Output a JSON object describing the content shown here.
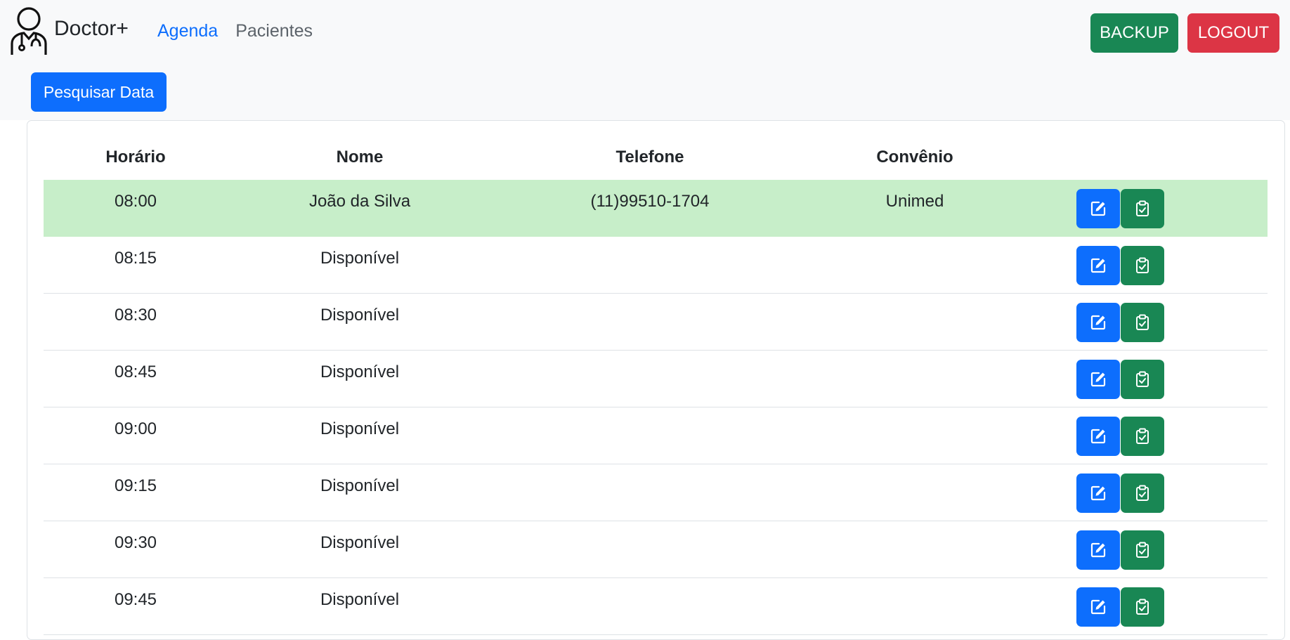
{
  "brand": {
    "name": "Doctor+",
    "icon": "doctor-icon"
  },
  "nav": {
    "agenda": "Agenda",
    "pacientes": "Pacientes"
  },
  "actions": {
    "backup": "BACKUP",
    "logout": "LOGOUT",
    "search_date": "Pesquisar Data"
  },
  "table": {
    "headers": [
      "Horário",
      "Nome",
      "Telefone",
      "Convênio"
    ],
    "rows": [
      {
        "time": "08:00",
        "name": "João da Silva",
        "phone": "(11)99510-1704",
        "plan": "Unimed",
        "highlight": true
      },
      {
        "time": "08:15",
        "name": "Disponível",
        "phone": "",
        "plan": ""
      },
      {
        "time": "08:30",
        "name": "Disponível",
        "phone": "",
        "plan": ""
      },
      {
        "time": "08:45",
        "name": "Disponível",
        "phone": "",
        "plan": ""
      },
      {
        "time": "09:00",
        "name": "Disponível",
        "phone": "",
        "plan": ""
      },
      {
        "time": "09:15",
        "name": "Disponível",
        "phone": "",
        "plan": ""
      },
      {
        "time": "09:30",
        "name": "Disponível",
        "phone": "",
        "plan": ""
      },
      {
        "time": "09:45",
        "name": "Disponível",
        "phone": "",
        "plan": ""
      }
    ],
    "row_actions": {
      "edit_icon": "edit-icon",
      "check_icon": "clipboard-check-icon"
    }
  },
  "colors": {
    "primary": "#0d6efd",
    "success": "#198754",
    "danger": "#dc3545",
    "navbar_bg": "#f8f9fa",
    "highlight_row": "#c7eec9"
  }
}
